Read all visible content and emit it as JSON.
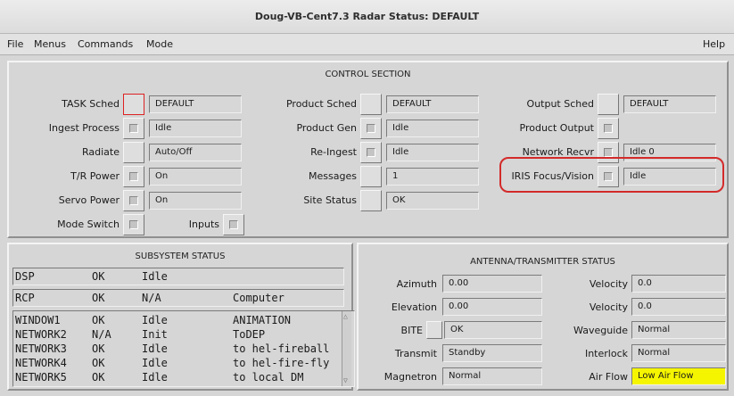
{
  "window": {
    "title": "Doug-VB-Cent7.3  Radar Status: DEFAULT"
  },
  "menubar": {
    "file": "File",
    "menus": "Menus",
    "commands": "Commands",
    "mode": "Mode",
    "help": "Help"
  },
  "control": {
    "title": "CONTROL SECTION",
    "task_sched": {
      "label": "TASK Sched",
      "value": "DEFAULT"
    },
    "ingest_process": {
      "label": "Ingest Process",
      "value": "Idle"
    },
    "radiate": {
      "label": "Radiate",
      "value": "Auto/Off"
    },
    "tr_power": {
      "label": "T/R Power",
      "value": "On"
    },
    "servo_power": {
      "label": "Servo Power",
      "value": "On"
    },
    "mode_switch": {
      "label": "Mode Switch"
    },
    "inputs": {
      "label": "Inputs"
    },
    "product_sched": {
      "label": "Product Sched",
      "value": "DEFAULT"
    },
    "product_gen": {
      "label": "Product Gen",
      "value": "Idle"
    },
    "re_ingest": {
      "label": "Re-Ingest",
      "value": "Idle"
    },
    "messages": {
      "label": "Messages",
      "value": "1"
    },
    "site_status": {
      "label": "Site Status",
      "value": "OK"
    },
    "output_sched": {
      "label": "Output Sched",
      "value": "DEFAULT"
    },
    "product_output": {
      "label": "Product Output"
    },
    "network_recvr": {
      "label": "Network Recvr",
      "value": "Idle  0"
    },
    "iris_focus": {
      "label": "IRIS Focus/Vision",
      "value": "Idle"
    }
  },
  "subsystem": {
    "title": "SUBSYSTEM STATUS",
    "dsp": {
      "name": "DSP",
      "status": "OK",
      "state": "Idle",
      "note": ""
    },
    "rcp": {
      "name": "RCP",
      "status": "OK",
      "state": "N/A",
      "note": "Computer"
    },
    "rows": [
      {
        "name": "WINDOW1",
        "status": "OK",
        "state": "Idle",
        "note": "ANIMATION"
      },
      {
        "name": "NETWORK2",
        "status": "N/A",
        "state": "Init",
        "note": "ToDEP"
      },
      {
        "name": "NETWORK3",
        "status": "OK",
        "state": "Idle",
        "note": "to hel-fireball"
      },
      {
        "name": "NETWORK4",
        "status": "OK",
        "state": "Idle",
        "note": "to hel-fire-fly"
      },
      {
        "name": "NETWORK5",
        "status": "OK",
        "state": "Idle",
        "note": "to local DM"
      }
    ]
  },
  "antenna": {
    "title": "ANTENNA/TRANSMITTER STATUS",
    "azimuth": {
      "label": "Azimuth",
      "value": "0.00"
    },
    "elevation": {
      "label": "Elevation",
      "value": "0.00"
    },
    "bite": {
      "label": "BITE",
      "value": "OK"
    },
    "transmit": {
      "label": "Transmit",
      "value": "Standby"
    },
    "magnetron": {
      "label": "Magnetron",
      "value": "Normal"
    },
    "velocity1": {
      "label": "Velocity",
      "value": "0.0"
    },
    "velocity2": {
      "label": "Velocity",
      "value": "0.0"
    },
    "waveguide": {
      "label": "Waveguide",
      "value": "Normal"
    },
    "interlock": {
      "label": "Interlock",
      "value": "Normal"
    },
    "air_flow": {
      "label": "Air Flow",
      "value": "Low Air Flow"
    }
  },
  "colors": {
    "highlight": "#d32a2a",
    "warning": "#f5f500"
  }
}
